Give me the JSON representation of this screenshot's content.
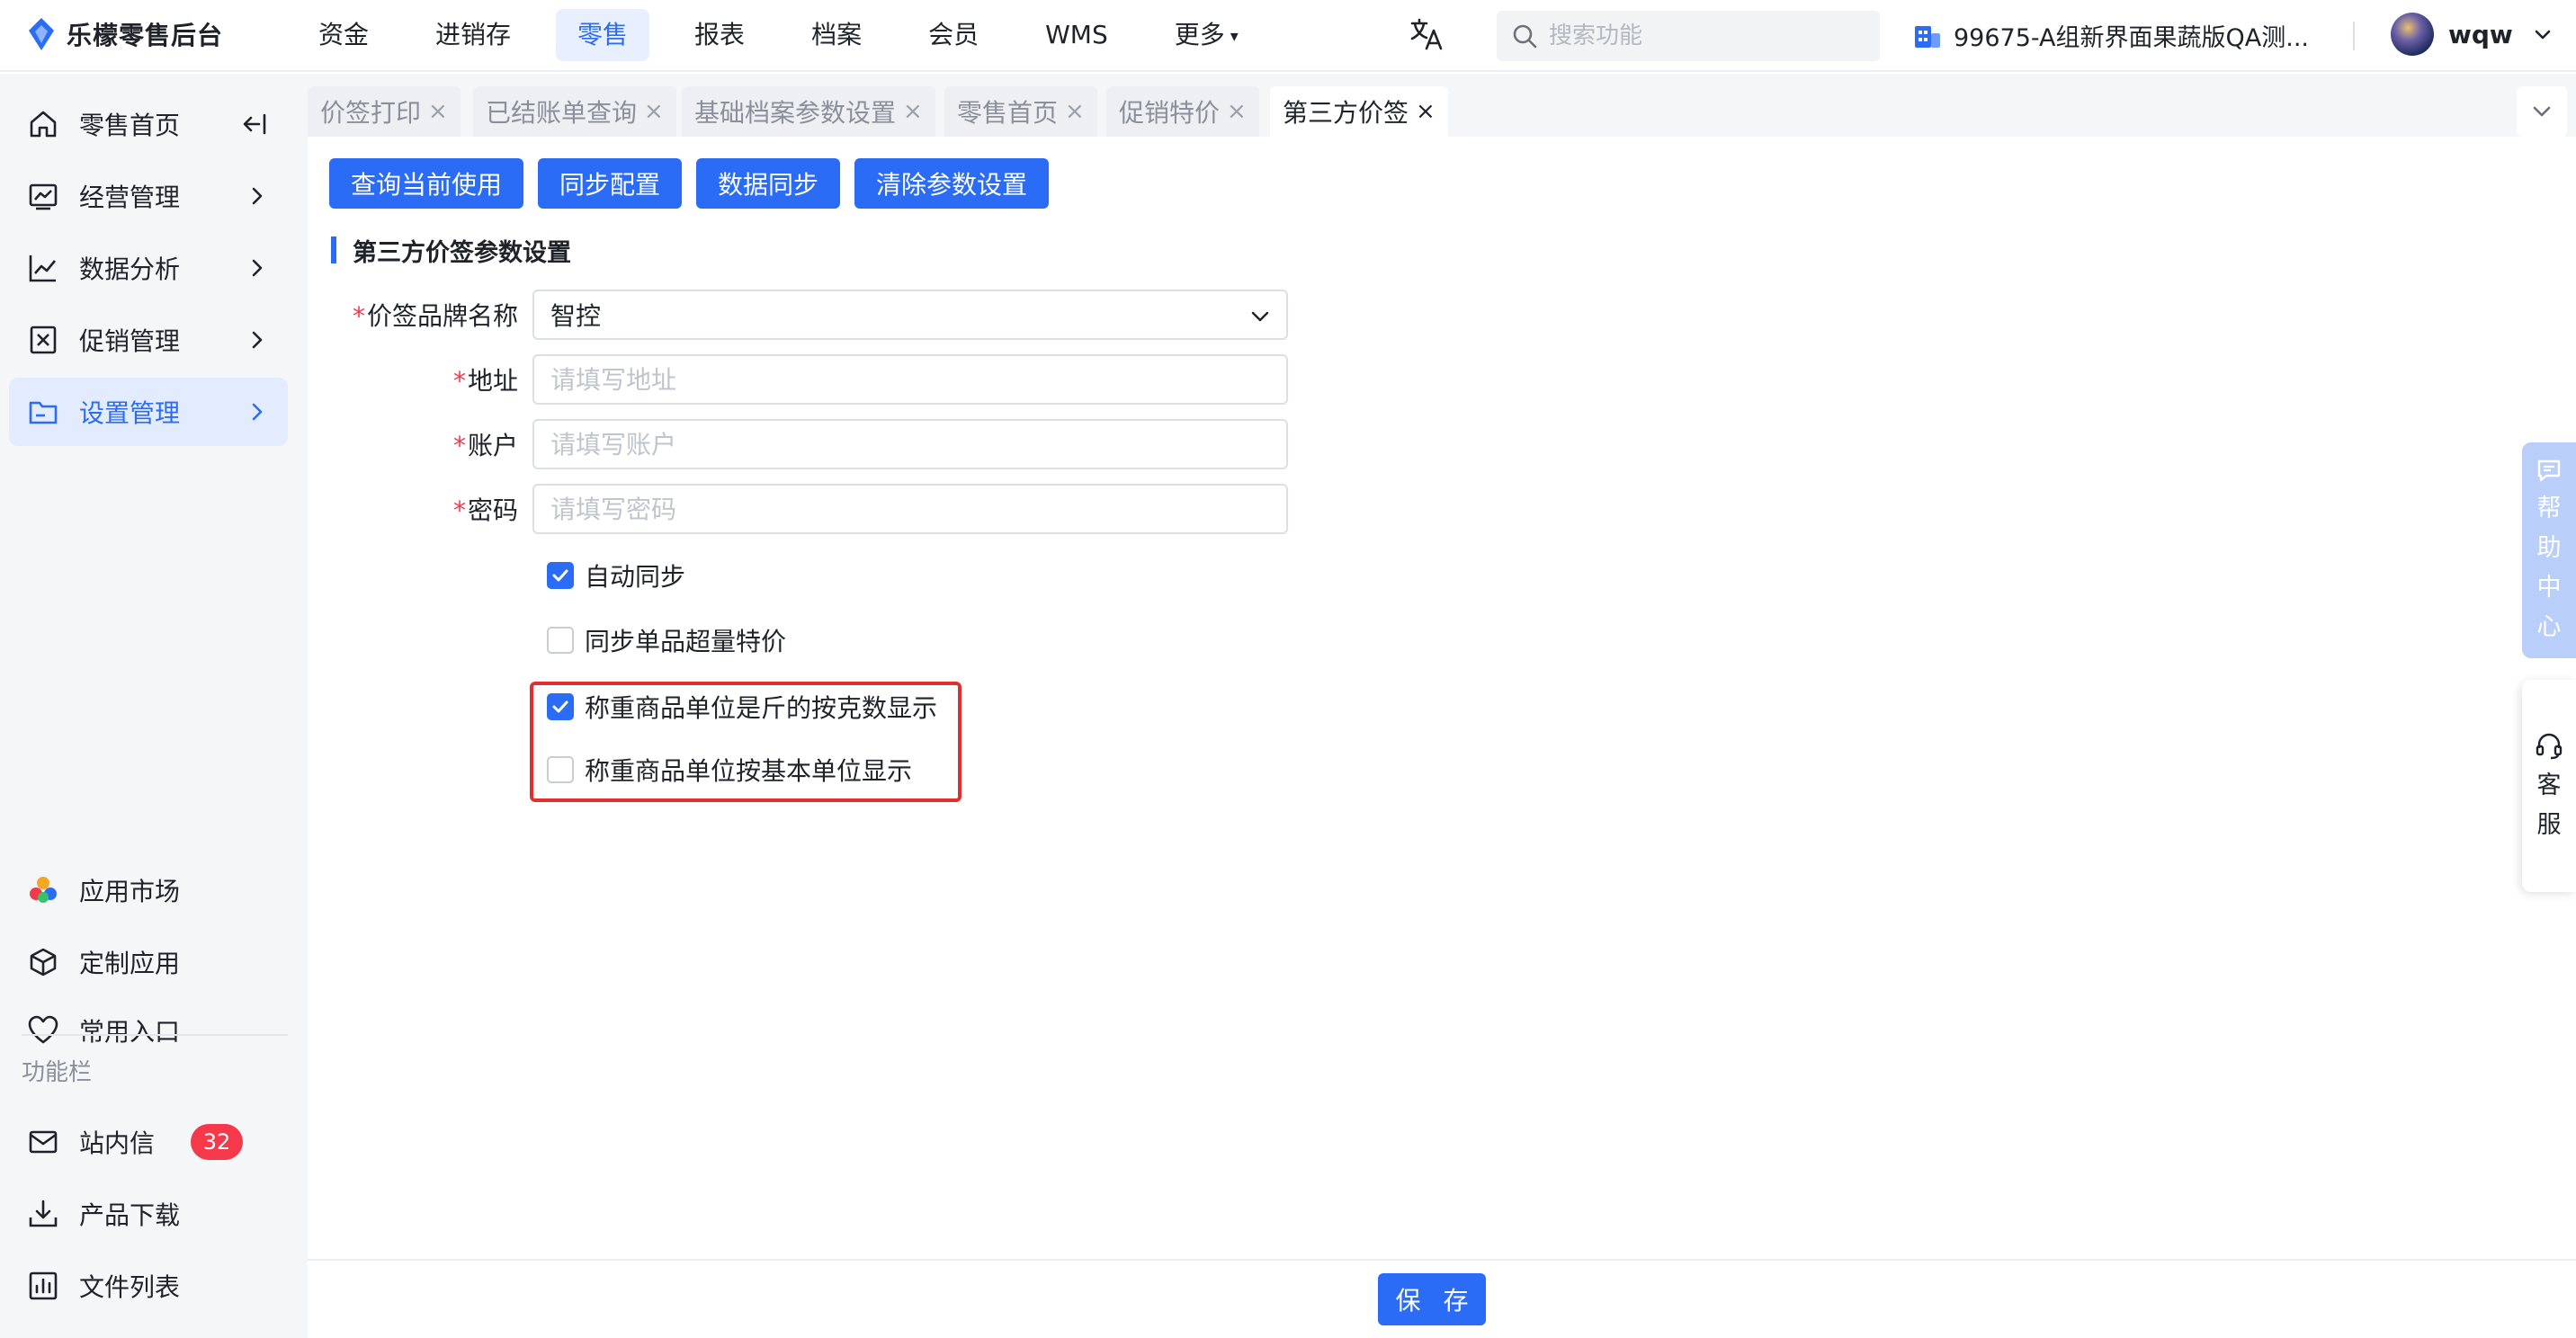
{
  "app": {
    "name": "乐檬零售后台"
  },
  "topnav": [
    {
      "label": "资金",
      "active": false
    },
    {
      "label": "进销存",
      "active": false
    },
    {
      "label": "零售",
      "active": true
    },
    {
      "label": "报表",
      "active": false
    },
    {
      "label": "档案",
      "active": false
    },
    {
      "label": "会员",
      "active": false
    },
    {
      "label": "WMS",
      "active": false
    },
    {
      "label": "更多",
      "active": false
    }
  ],
  "search": {
    "placeholder": "搜索功能",
    "value": ""
  },
  "org": {
    "name": "99675-A组新界面果蔬版QA测..."
  },
  "user": {
    "name": "wqw"
  },
  "sidebar": {
    "items": [
      {
        "label": "零售首页",
        "icon": "home-icon"
      },
      {
        "label": "经营管理",
        "icon": "business-icon"
      },
      {
        "label": "数据分析",
        "icon": "chart-icon"
      },
      {
        "label": "促销管理",
        "icon": "promotion-icon"
      },
      {
        "label": "设置管理",
        "icon": "folder-icon",
        "active": true
      }
    ],
    "bottom": [
      {
        "label": "应用市场",
        "icon": "app-market-icon"
      },
      {
        "label": "定制应用",
        "icon": "cube-icon"
      },
      {
        "label": "常用入口",
        "icon": "heart-icon"
      }
    ],
    "section_title": "功能栏",
    "tools": [
      {
        "label": "站内信",
        "icon": "mail-icon",
        "badge": "32"
      },
      {
        "label": "产品下载",
        "icon": "download-icon"
      },
      {
        "label": "文件列表",
        "icon": "file-list-icon"
      }
    ]
  },
  "tabs": [
    {
      "label": "价签打印",
      "close": "×"
    },
    {
      "label": "已结账单查询",
      "close": "×"
    },
    {
      "label": "基础档案参数设置",
      "close": "×"
    },
    {
      "label": "零售首页",
      "close": "×"
    },
    {
      "label": "促销特价",
      "close": "×"
    },
    {
      "label": "第三方价签",
      "close": "×",
      "active": true
    }
  ],
  "toolbar": {
    "query_label": "查询当前使用",
    "sync_config_label": "同步配置",
    "data_sync_label": "数据同步",
    "clear_label": "清除参数设置"
  },
  "section": {
    "title": "第三方价签参数设置"
  },
  "form": {
    "required_mark": "*",
    "brand": {
      "label": "价签品牌名称",
      "value": "智控"
    },
    "address": {
      "label": "地址",
      "placeholder": "请填写地址",
      "value": ""
    },
    "account": {
      "label": "账户",
      "placeholder": "请填写账户",
      "value": ""
    },
    "password": {
      "label": "密码",
      "placeholder": "请填写密码",
      "value": ""
    },
    "checkboxes": [
      {
        "label": "自动同步",
        "checked": true
      },
      {
        "label": "同步单品超量特价",
        "checked": false
      },
      {
        "label": "称重商品单位是斤的按克数显示",
        "checked": true
      },
      {
        "label": "称重商品单位按基本单位显示",
        "checked": false
      }
    ]
  },
  "footer": {
    "save_label": "保 存"
  },
  "float_panels": {
    "help": "帮助中心",
    "service": "客服"
  },
  "colors": {
    "accent": "#2b6cf6",
    "highlight": "#e0302e",
    "badge": "#f5384a"
  }
}
